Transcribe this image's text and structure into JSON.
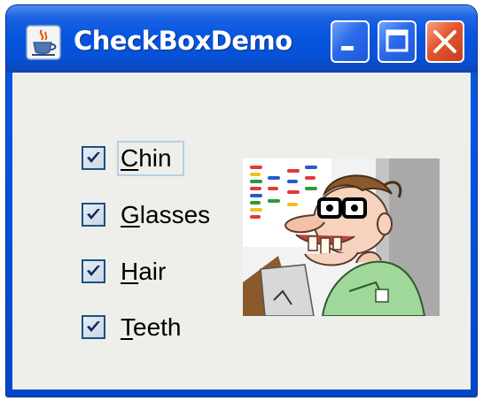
{
  "window": {
    "title": "CheckBoxDemo",
    "icons": {
      "app": "java-coffee-cup-icon",
      "minimize": "minimize-icon",
      "maximize": "maximize-icon",
      "close": "close-icon"
    }
  },
  "checkboxes": [
    {
      "label": "Chin",
      "mnemonic": "C",
      "rest": "hin",
      "checked": true,
      "focused": true
    },
    {
      "label": "Glasses",
      "mnemonic": "G",
      "rest": "lasses",
      "checked": true,
      "focused": false
    },
    {
      "label": "Hair",
      "mnemonic": "H",
      "rest": "air",
      "checked": true,
      "focused": false
    },
    {
      "label": "Teeth",
      "mnemonic": "T",
      "rest": "eeth",
      "checked": true,
      "focused": false
    }
  ],
  "picture": {
    "subject": "geek-cartoon-character"
  }
}
